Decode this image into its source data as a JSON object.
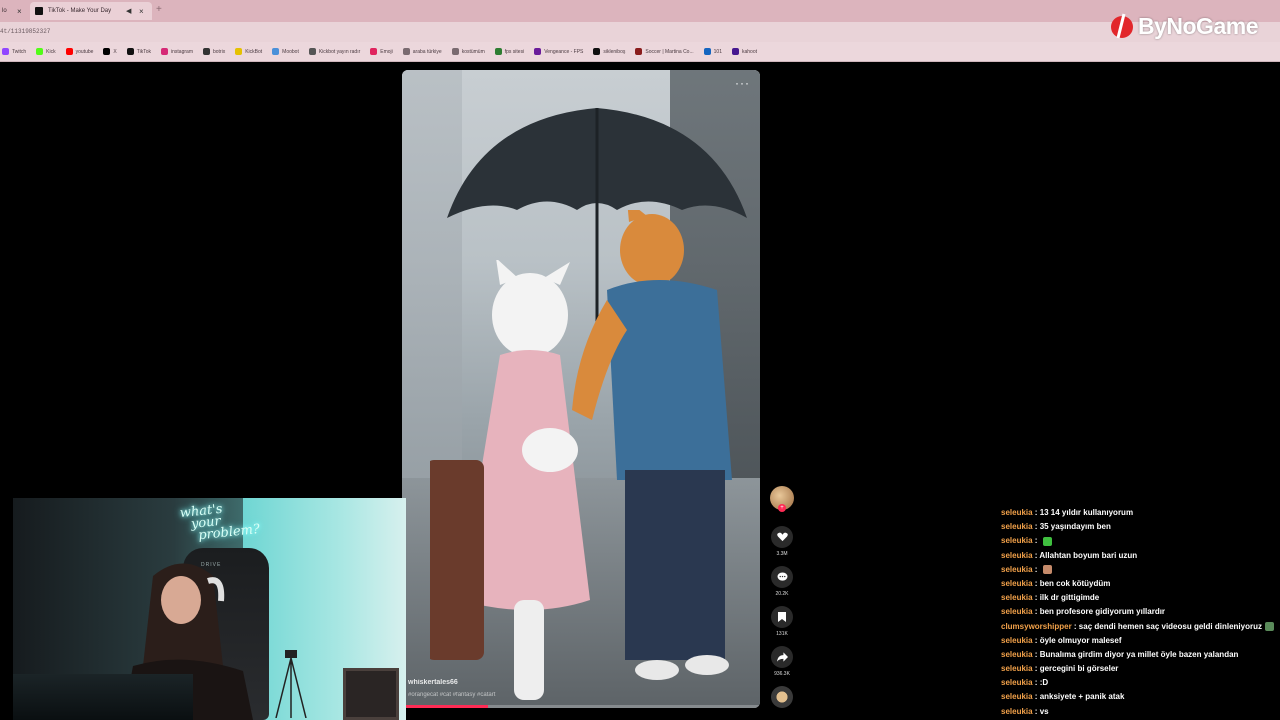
{
  "browser": {
    "tabs": [
      {
        "label": "lo"
      },
      {
        "label": "TikTok - Make Your Day"
      }
    ],
    "address": "4t/11319852327",
    "bookmarks": [
      {
        "label": "Twitch",
        "color": "#9146ff"
      },
      {
        "label": "Kick",
        "color": "#53fc18"
      },
      {
        "label": "youtube",
        "color": "#ff0000"
      },
      {
        "label": "X",
        "color": "#000000"
      },
      {
        "label": "TikTok",
        "color": "#111111"
      },
      {
        "label": "instagram",
        "color": "#d62976"
      },
      {
        "label": "botrix",
        "color": "#333333"
      },
      {
        "label": "KickBot",
        "color": "#e5c100"
      },
      {
        "label": "Moobot",
        "color": "#4a90d9"
      },
      {
        "label": "Kickbot yayın radır",
        "color": "#555555"
      },
      {
        "label": "Emoji",
        "color": "#e0245e"
      },
      {
        "label": "araba türkiye",
        "color": "#7a6a70"
      },
      {
        "label": "kostümüm",
        "color": "#7a6a70"
      },
      {
        "label": "fps sitesi",
        "color": "#2e7d32"
      },
      {
        "label": "Vengeance - FPS",
        "color": "#6a1b9a"
      },
      {
        "label": "sikleniboş",
        "color": "#111111"
      },
      {
        "label": "Soccer | Martina Co...",
        "color": "#8a1c1c"
      },
      {
        "label": "101",
        "color": "#1565c0"
      },
      {
        "label": "kahoot",
        "color": "#46178f"
      }
    ]
  },
  "logo": {
    "text": "ByNoGame",
    "accent": "#e2262b"
  },
  "video": {
    "author": "whiskertales66",
    "tags": "#orangecat #cat #fantasy #catart",
    "progress": 0.24,
    "accent": "#fe2c55"
  },
  "actions": {
    "likes": "3.3M",
    "comments": "20.2K",
    "saves": "131K",
    "shares": "936.3K"
  },
  "webcam": {
    "neon_text": [
      "what's",
      "your",
      "problem?"
    ],
    "chair_brand": "DRIVE"
  },
  "chat": [
    {
      "user": "seleukia",
      "text": "13 14 yıldır kullanıyorum"
    },
    {
      "user": "seleukia",
      "text": "35 yaşındayım ben"
    },
    {
      "user": "seleukia",
      "text": "",
      "emote": "#3fbf3f"
    },
    {
      "user": "seleukia",
      "text": "Allahtan boyum bari uzun"
    },
    {
      "user": "seleukia",
      "text": "",
      "emote": "#c58a6a"
    },
    {
      "user": "seleukia",
      "text": "ben cok kötüydüm"
    },
    {
      "user": "seleukia",
      "text": "ilk dr gittigimde"
    },
    {
      "user": "seleukia",
      "text": "ben profesore gidiyorum yıllardır"
    },
    {
      "user": "clumsyworshipper",
      "text": "saç dendi hemen saç videosu geldi dinleniyoruz",
      "emote": "#5a8a5a"
    },
    {
      "user": "seleukia",
      "text": "öyle olmuyor malesef"
    },
    {
      "user": "seleukia",
      "text": "Bunalıma girdim diyor ya millet öyle bazen yalandan"
    },
    {
      "user": "seleukia",
      "text": "gercegini bi görseler"
    },
    {
      "user": "seleukia",
      "text": ":D"
    },
    {
      "user": "seleukia",
      "text": "anksiyete + panik atak"
    },
    {
      "user": "seleukia",
      "text": "vs"
    }
  ]
}
